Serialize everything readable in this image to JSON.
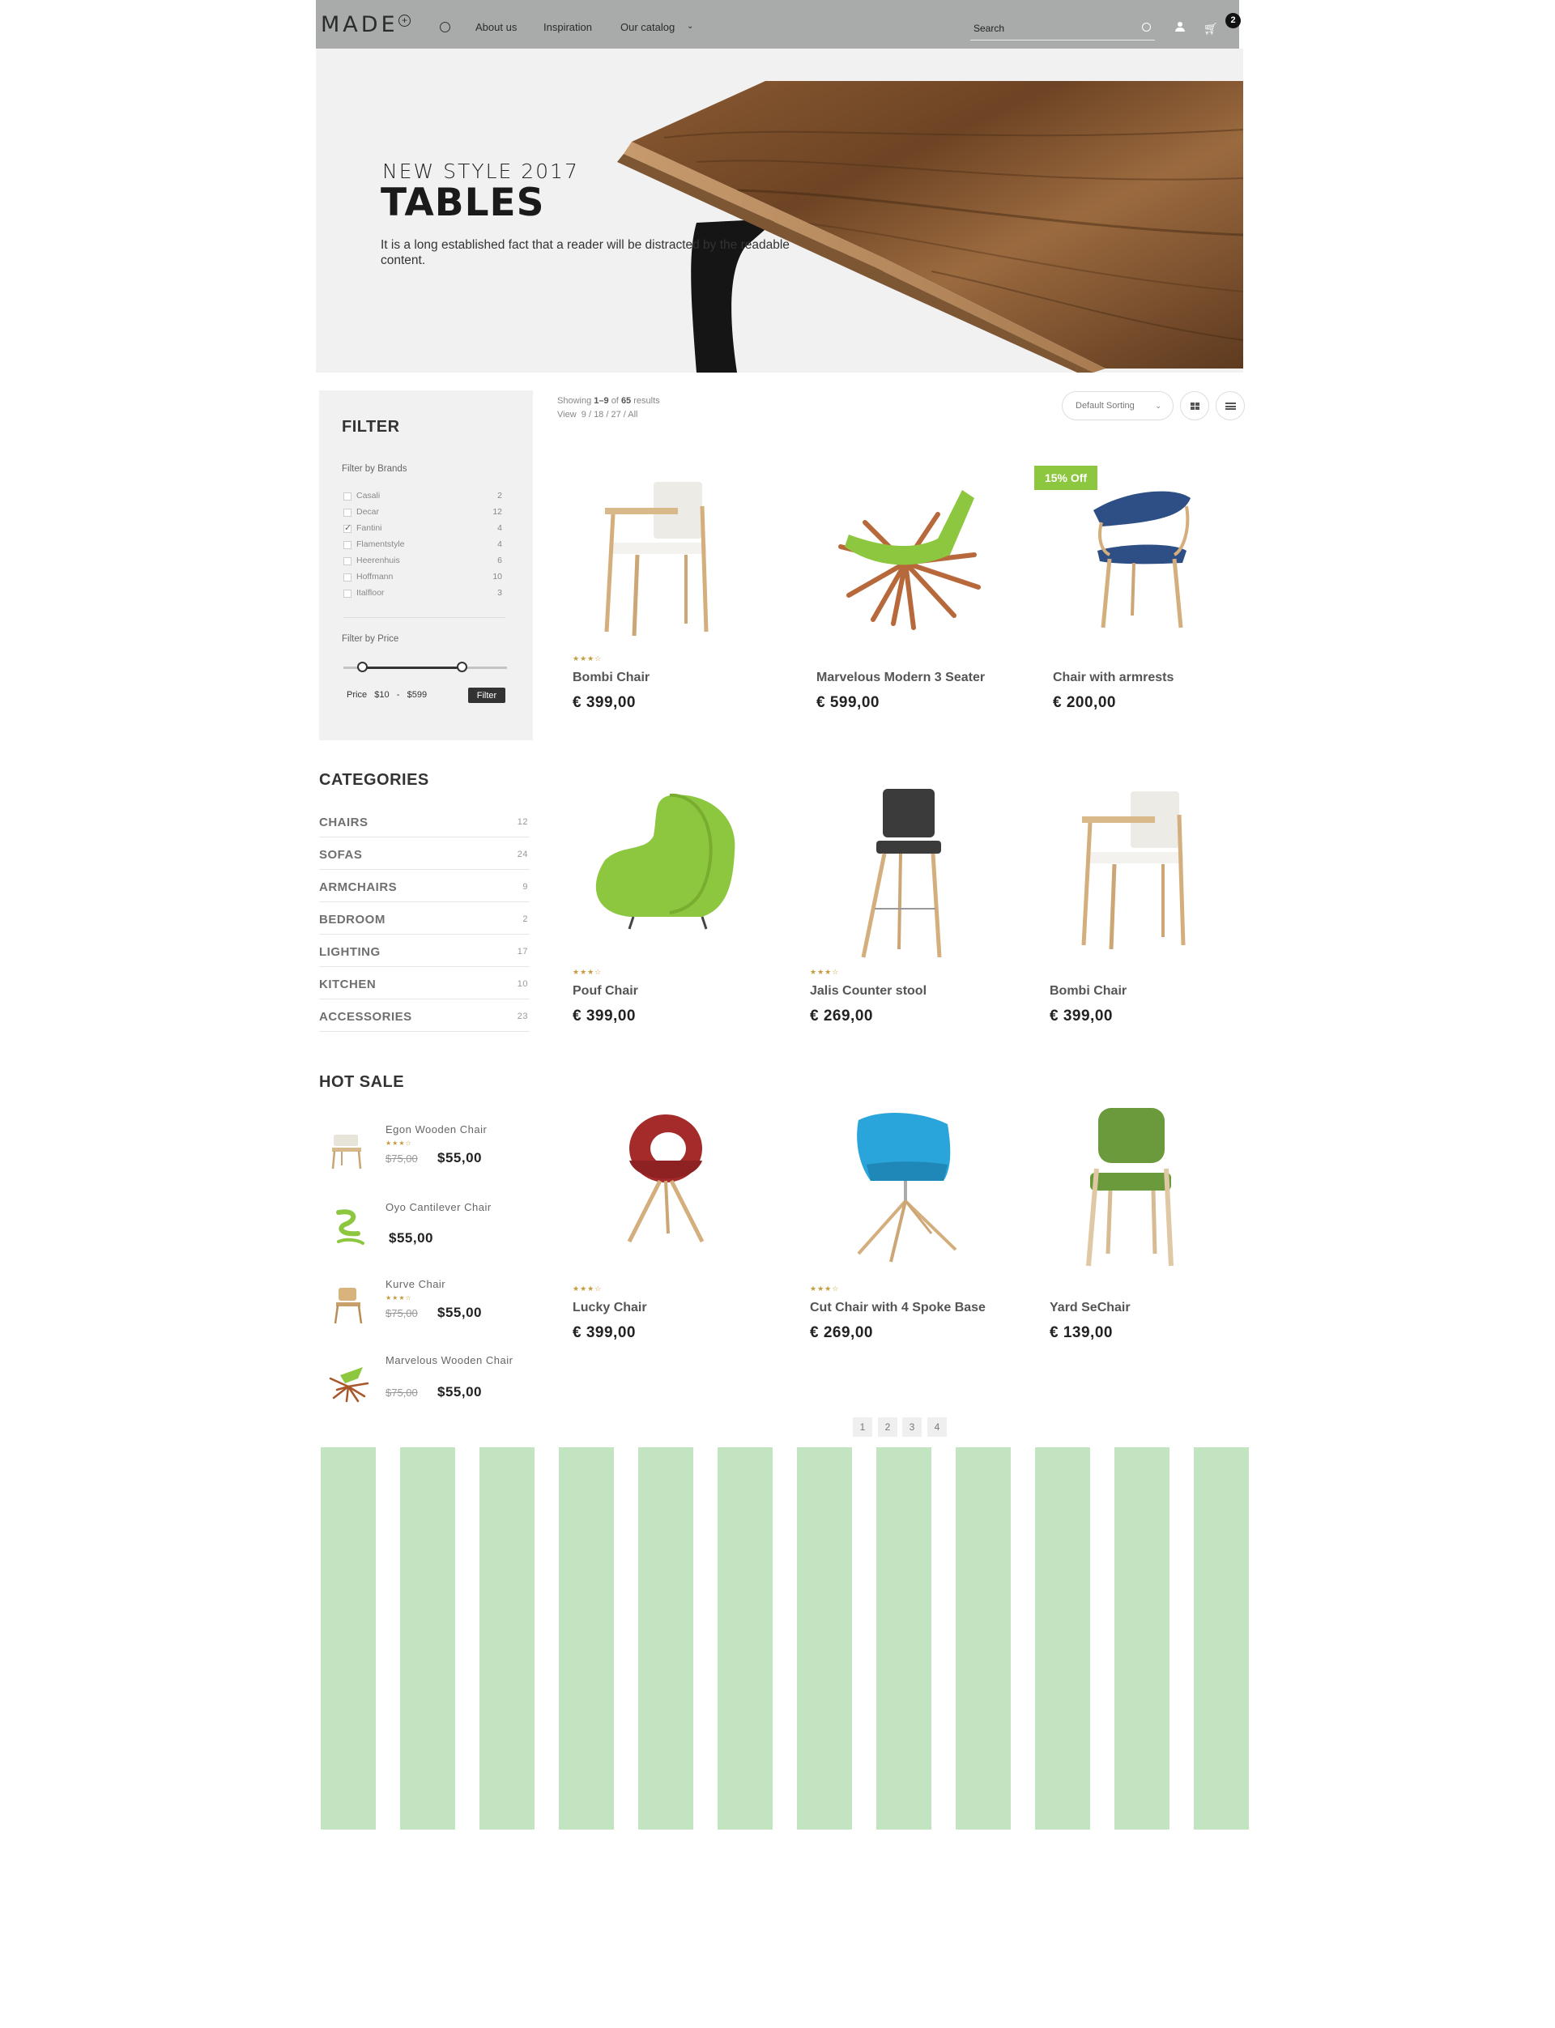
{
  "header": {
    "logo": "MADE",
    "nav": [
      "About us",
      "Inspiration",
      "Our catalog"
    ],
    "search_placeholder": "Search",
    "cart_count": "2",
    "icons": [
      "globe-icon",
      "chevron-down-icon",
      "search-icon",
      "user-icon",
      "cart-icon"
    ]
  },
  "hero": {
    "kicker": "NEW STYLE 2017",
    "title": "TABLES",
    "description": "It is a long established fact that a reader will be distracted by the readable content."
  },
  "filter": {
    "title": "FILTER",
    "brands_title": "Filter by Brands",
    "brands": [
      {
        "name": "Casali",
        "count": "2",
        "checked": false
      },
      {
        "name": "Decar",
        "count": "12",
        "checked": false
      },
      {
        "name": "Fantini",
        "count": "4",
        "checked": true
      },
      {
        "name": "Flamentstyle",
        "count": "4",
        "checked": false
      },
      {
        "name": "Heerenhuis",
        "count": "6",
        "checked": false
      },
      {
        "name": "Hoffmann",
        "count": "10",
        "checked": false
      },
      {
        "name": "Italfloor",
        "count": "3",
        "checked": false
      }
    ],
    "price_title": "Filter by Price",
    "price_label": "Price",
    "price_min": "$10",
    "price_sep": "-",
    "price_max": "$599",
    "filter_button": "Filter"
  },
  "categories": {
    "title": "CATEGORIES",
    "items": [
      {
        "name": "CHAIRS",
        "count": "12"
      },
      {
        "name": "SOFAS",
        "count": "24"
      },
      {
        "name": "ARMCHAIRS",
        "count": "9"
      },
      {
        "name": "BEDROOM",
        "count": "2"
      },
      {
        "name": "LIGHTING",
        "count": "17"
      },
      {
        "name": "KITCHEN",
        "count": "10"
      },
      {
        "name": "ACCESSORIES",
        "count": "23"
      }
    ]
  },
  "hot_sale": {
    "title": "HOT SALE",
    "items": [
      {
        "name": "Egon Wooden Chair",
        "stars": "★★★☆",
        "old_price": "$75,00",
        "price": "$55,00"
      },
      {
        "name": "Oyo Cantilever Chair",
        "stars": "",
        "old_price": "",
        "price": "$55,00"
      },
      {
        "name": "Kurve Chair",
        "stars": "★★★☆",
        "old_price": "$75,00",
        "price": "$55,00"
      },
      {
        "name": "Marvelous Wooden Chair",
        "stars": "",
        "old_price": "$75,00",
        "price": "$55,00"
      }
    ]
  },
  "listing": {
    "showing_prefix": "Showing",
    "showing_range": "1–9",
    "showing_of": "of",
    "showing_total": "65",
    "showing_suffix": "results",
    "view_label": "View",
    "view_options": "9 / 18 / 27 / All",
    "sort_label": "Default Sorting"
  },
  "sale_badge": "15% Off",
  "products": [
    {
      "name": "Bombi Chair",
      "price": "€ 399,00",
      "stars": "★★★☆"
    },
    {
      "name": "Marvelous Modern 3 Seater",
      "price": "€ 599,00",
      "stars": ""
    },
    {
      "name": "Chair with armrests",
      "price": "€ 200,00",
      "stars": ""
    },
    {
      "name": "Pouf Chair",
      "price": "€ 399,00",
      "stars": "★★★☆"
    },
    {
      "name": "Jalis Counter stool",
      "price": "€ 269,00",
      "stars": "★★★☆"
    },
    {
      "name": "Bombi Chair",
      "price": "€ 399,00",
      "stars": ""
    },
    {
      "name": "Lucky Chair",
      "price": "€ 399,00",
      "stars": "★★★☆"
    },
    {
      "name": "Cut Chair with 4  Spoke Base",
      "price": "€ 269,00",
      "stars": "★★★☆"
    },
    {
      "name": "Yard SeChair",
      "price": "€ 139,00",
      "stars": ""
    }
  ],
  "pagination": [
    "1",
    "2",
    "3",
    "4"
  ],
  "colors": {
    "header_bg": "#a8abaa",
    "panel_bg": "#f1f1f1",
    "sale_green": "#8dc63f",
    "stripe_green": "#c2e4c0",
    "star_gold": "#c49a3a"
  }
}
